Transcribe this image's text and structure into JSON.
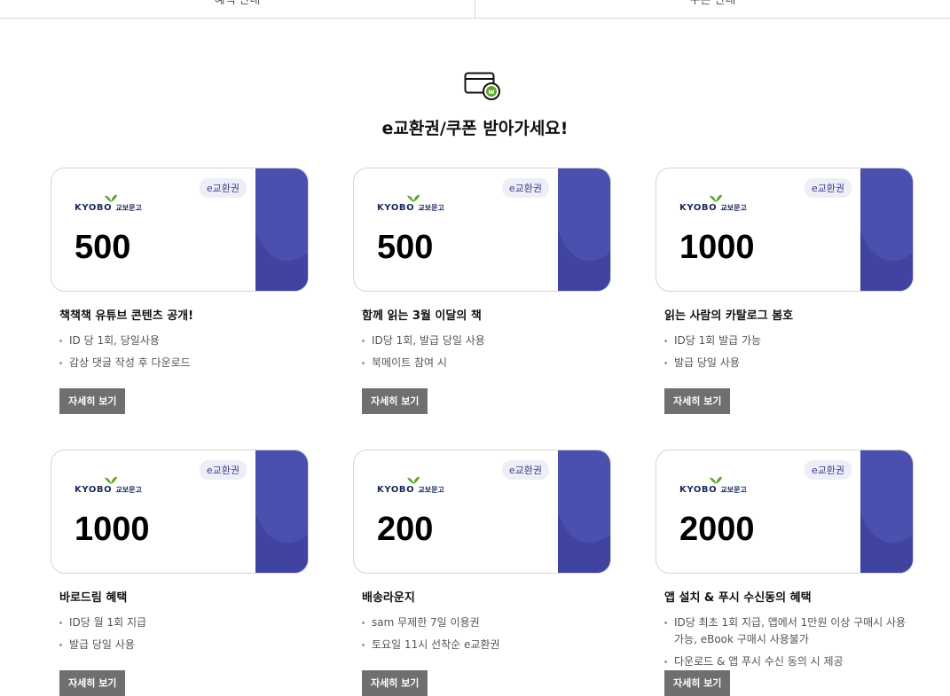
{
  "top_tabs": [
    {
      "label": "혜택 안내"
    },
    {
      "label": "쿠폰 안내"
    }
  ],
  "section": {
    "icon": "wallet-coupon-icon",
    "title": "e교환권/쿠폰 받아가세요!"
  },
  "colors": {
    "stripe": "#4b4fad",
    "stripe_dark": "#4044a0",
    "brand_green": "#5aa62a",
    "button": "#6f6f6f"
  },
  "coupons": [
    {
      "tag": "e교환권",
      "brand": "KYOBO",
      "brand_kr": "교보문고",
      "amount": "500",
      "title": "책책책 유튜브 콘텐츠 공개!",
      "benefits": [
        "ID 당 1회, 당일사용",
        "감상 댓글 작성 후 다운로드"
      ],
      "button": "자세히 보기"
    },
    {
      "tag": "e교환권",
      "brand": "KYOBO",
      "brand_kr": "교보문고",
      "amount": "500",
      "title": "함께 읽는 3월 이달의 책",
      "benefits": [
        "ID당 1회, 발급 당일 사용",
        "북메이트 참여 시"
      ],
      "button": "자세히 보기"
    },
    {
      "tag": "e교환권",
      "brand": "KYOBO",
      "brand_kr": "교보문고",
      "amount": "1000",
      "title": "읽는 사람의 카탈로그 봄호",
      "benefits": [
        "ID당 1회 발급 가능",
        "발급 당일 사용"
      ],
      "button": "자세히 보기"
    },
    {
      "tag": "e교환권",
      "brand": "KYOBO",
      "brand_kr": "교보문고",
      "amount": "1000",
      "title": "바로드림 혜택",
      "benefits": [
        "ID당 월 1회 지급",
        "발급 당일 사용"
      ],
      "button": "자세히 보기"
    },
    {
      "tag": "e교환권",
      "brand": "KYOBO",
      "brand_kr": "교보문고",
      "amount": "200",
      "title": "배송라운지",
      "benefits": [
        "sam 무제한 7일 이용권",
        "토요일 11시 선착순 e교환권"
      ],
      "button": "자세히 보기"
    },
    {
      "tag": "e교환권",
      "brand": "KYOBO",
      "brand_kr": "교보문고",
      "amount": "2000",
      "title": "앱 설치 & 푸시 수신동의 혜택",
      "benefits": [
        "ID당 최초 1회 지급, 앱에서 1만원 이상 구매시 사용 가능, eBook 구매시 사용불가",
        "다운로드 & 앱 푸시 수신 동의 시 제공"
      ],
      "button": "자세히 보기"
    }
  ]
}
